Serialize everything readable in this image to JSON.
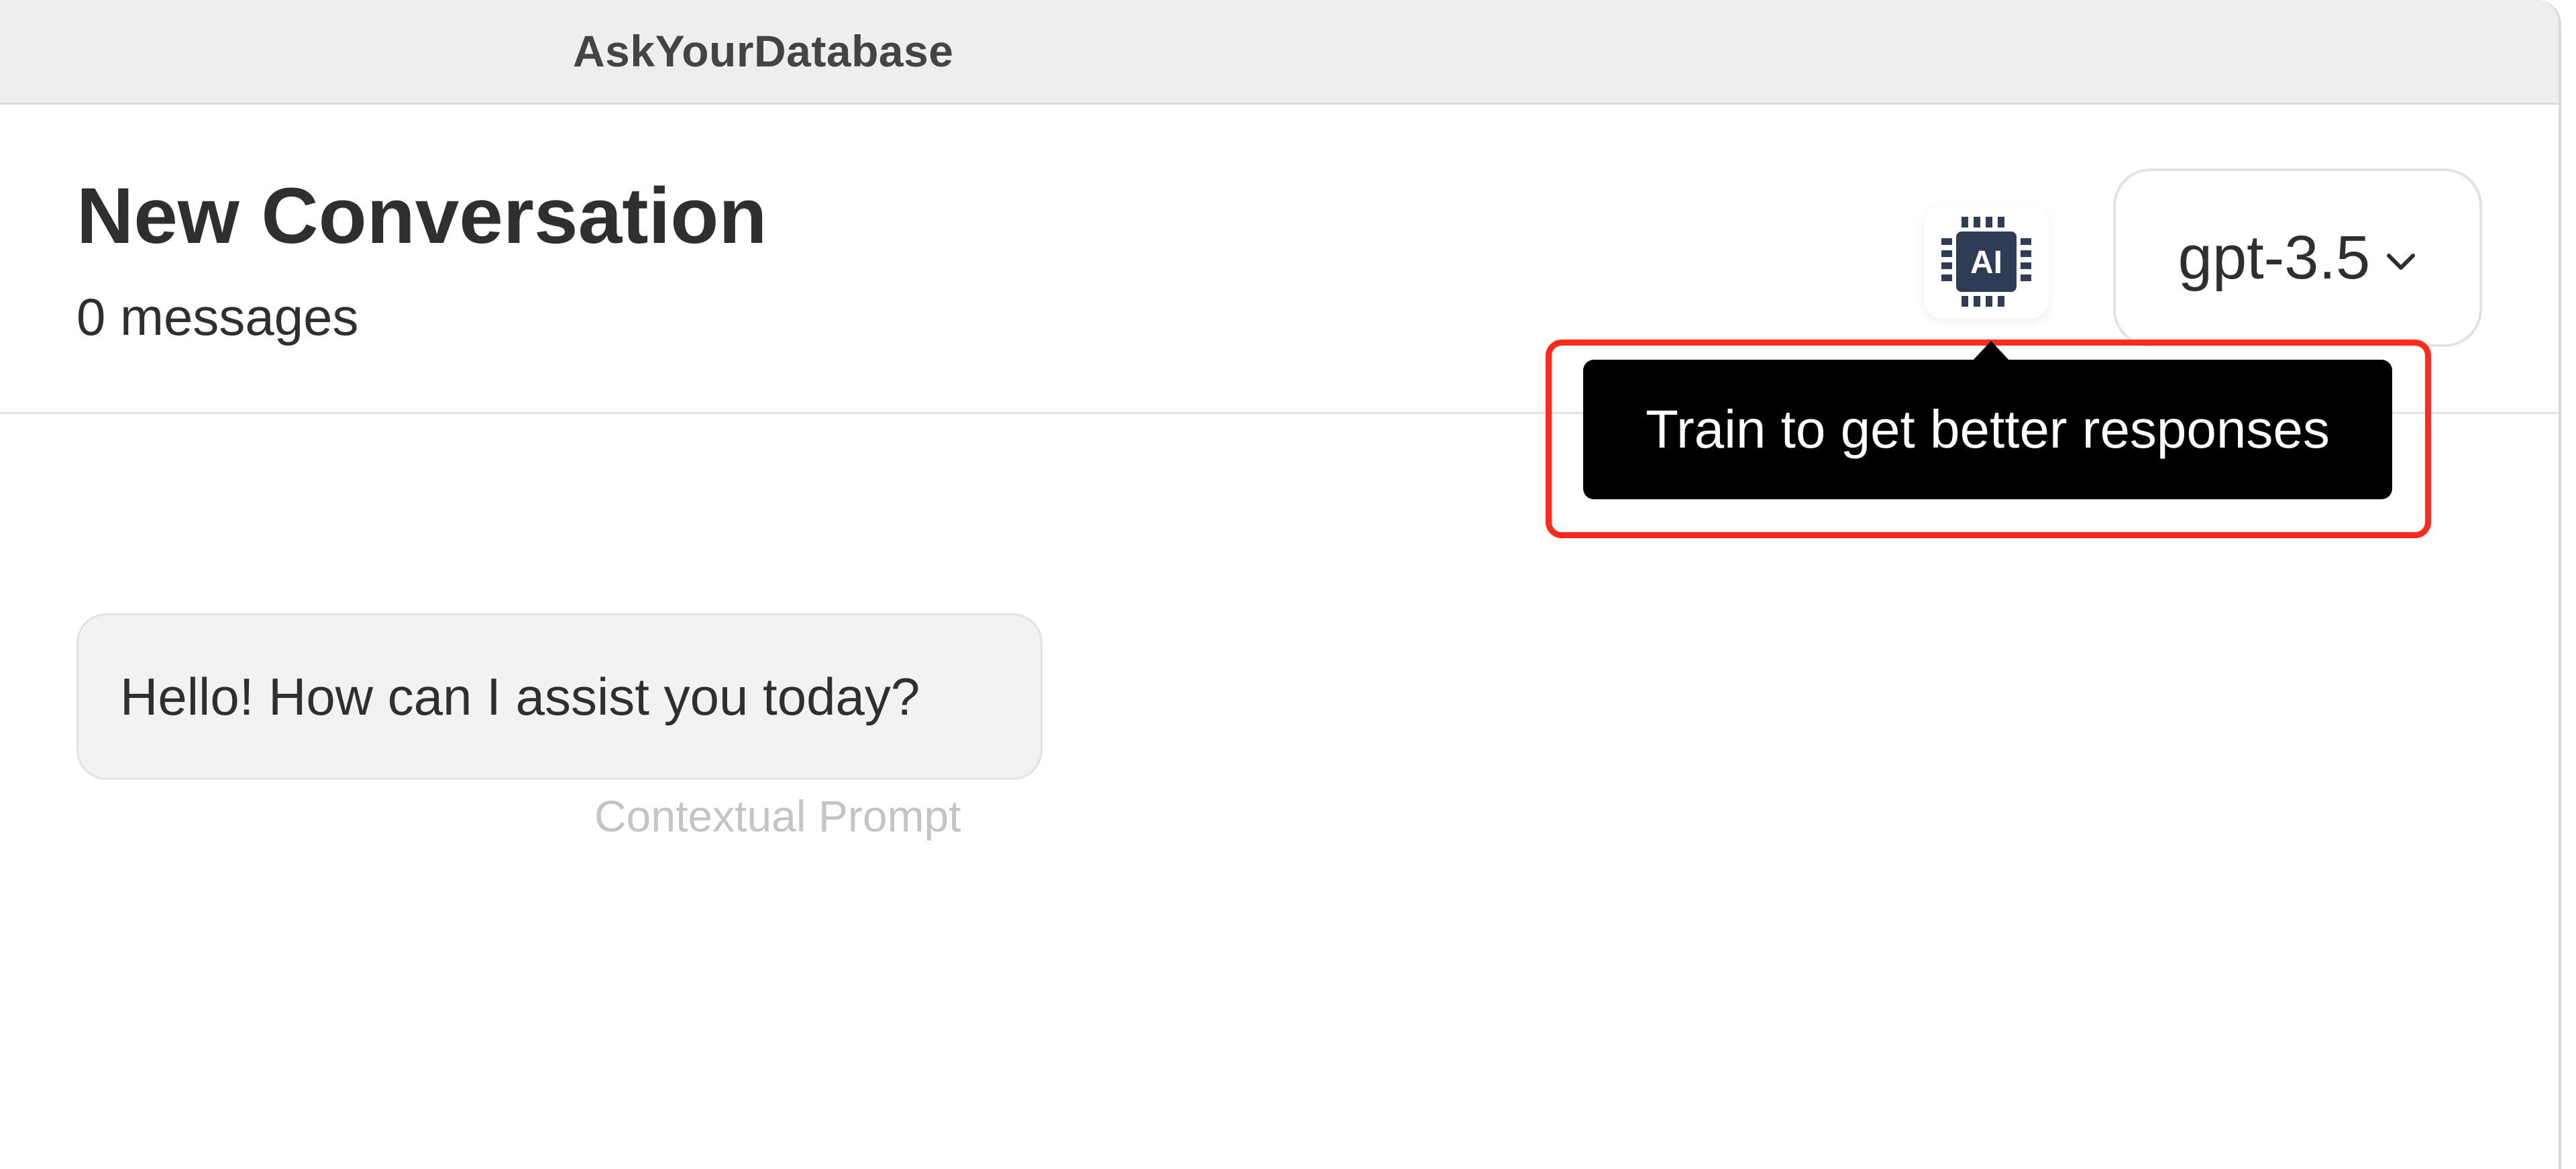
{
  "app": {
    "title": "AskYourDatabase"
  },
  "conversation": {
    "title": "New Conversation",
    "message_count": "0 messages"
  },
  "toolbar": {
    "ai_icon_label": "AI",
    "model": "gpt-3.5"
  },
  "tooltip": {
    "text": "Train to get better responses"
  },
  "messages": [
    {
      "text": "Hello! How can I assist you today?",
      "caption": "Contextual Prompt"
    }
  ],
  "colors": {
    "highlight": "#ff2a1a",
    "tooltip_bg": "#000000",
    "ai_icon": "#2e3d55"
  },
  "icons": [
    "ai-chip-icon",
    "chevron-down-icon"
  ]
}
